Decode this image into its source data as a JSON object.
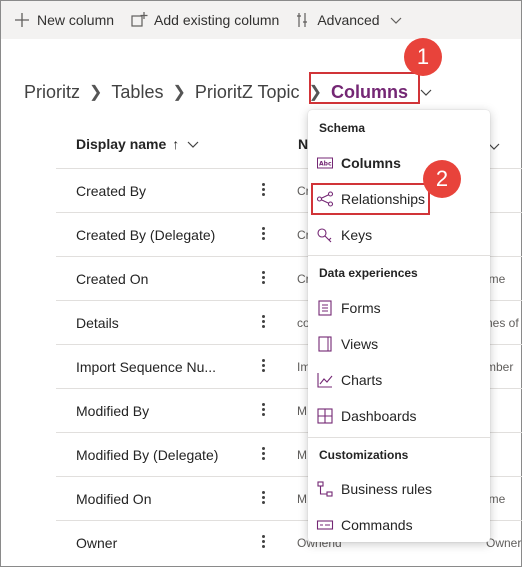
{
  "toolbar": {
    "new_column": "New column",
    "add_existing": "Add existing column",
    "advanced": "Advanced"
  },
  "breadcrumb": {
    "items": [
      "Prioritz",
      "Tables",
      "PrioritZ Topic"
    ],
    "current": "Columns"
  },
  "callouts": {
    "one": "1",
    "two": "2"
  },
  "table": {
    "headers": {
      "display_name": "Display name",
      "sort_indicator": "↑",
      "name_partial": "N"
    },
    "rows": [
      {
        "display_name": "Created By",
        "name": "Cr",
        "extra": ""
      },
      {
        "display_name": "Created By (Delegate)",
        "name": "Cr",
        "extra": ""
      },
      {
        "display_name": "Created On",
        "name": "Cr",
        "extra": "ime"
      },
      {
        "display_name": "Details",
        "name": "co",
        "extra": "nes of"
      },
      {
        "display_name": "Import Sequence Nu...",
        "name": "Im",
        "extra": "mber"
      },
      {
        "display_name": "Modified By",
        "name": "M",
        "extra": ""
      },
      {
        "display_name": "Modified By (Delegate)",
        "name": "M",
        "extra": ""
      },
      {
        "display_name": "Modified On",
        "name": "M",
        "extra": "ime"
      },
      {
        "display_name": "Owner",
        "name": "Ownerid",
        "extra": "Owner"
      }
    ]
  },
  "menu": {
    "schema_header": "Schema",
    "schema_items": [
      "Columns",
      "Relationships",
      "Keys"
    ],
    "data_header": "Data experiences",
    "data_items": [
      "Forms",
      "Views",
      "Charts",
      "Dashboards"
    ],
    "custom_header": "Customizations",
    "custom_items": [
      "Business rules",
      "Commands"
    ]
  },
  "colors": {
    "accent": "#742774",
    "highlight": "#d13438",
    "callout": "#e8433b"
  }
}
